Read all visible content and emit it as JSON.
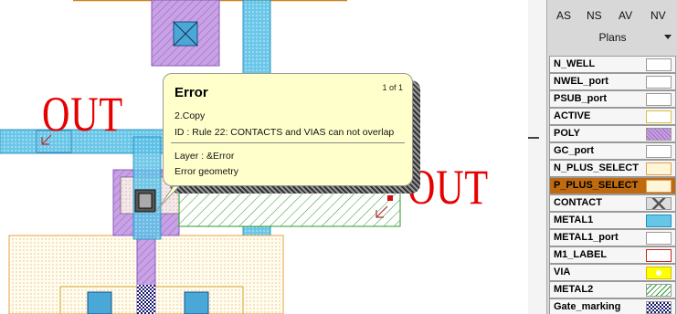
{
  "labels": {
    "out_left": "OUT",
    "out_right": "OUT"
  },
  "tooltip": {
    "title": "Error",
    "page": "1 of 1",
    "item": "2.Copy",
    "rule": "ID : Rule 22: CONTACTS and VIAS can not overlap",
    "layer": "Layer : &Error",
    "geometry": "Error geometry"
  },
  "panel": {
    "tabs": [
      "AS",
      "NS",
      "AV",
      "NV"
    ],
    "plans_label": "Plans",
    "layers": [
      {
        "name": "N_WELL",
        "swatch": "#ffffff",
        "pattern": "none"
      },
      {
        "name": "NWEL_port",
        "swatch": "#ffffff",
        "pattern": "none"
      },
      {
        "name": "PSUB_port",
        "swatch": "#ffffff",
        "pattern": "none"
      },
      {
        "name": "ACTIVE",
        "swatch": "#ffffe0",
        "pattern": "outline-yellow"
      },
      {
        "name": "POLY",
        "swatch": "#c8a0e0",
        "pattern": "hatch-purple"
      },
      {
        "name": "GC_port",
        "swatch": "#ffffff",
        "pattern": "none"
      },
      {
        "name": "N_PLUS_SELECT",
        "swatch": "#fff0c0",
        "pattern": "dots-orange"
      },
      {
        "name": "P_PLUS_SELECT",
        "swatch": "#fff0c0",
        "pattern": "dots-orange",
        "selected": true
      },
      {
        "name": "CONTACT",
        "swatch": "#d0d0d0",
        "pattern": "cross"
      },
      {
        "name": "METAL1",
        "swatch": "#66c6e8",
        "pattern": "metal1"
      },
      {
        "name": "METAL1_port",
        "swatch": "#ffffff",
        "pattern": "none"
      },
      {
        "name": "M1_LABEL",
        "swatch": "#ffffff",
        "pattern": "outline-red"
      },
      {
        "name": "VIA",
        "swatch": "#ffff00",
        "pattern": "via"
      },
      {
        "name": "METAL2",
        "swatch": "#ffffff",
        "pattern": "hatch-green"
      },
      {
        "name": "Gate_marking",
        "swatch": "#2a2a80",
        "pattern": "checker-navy"
      }
    ]
  }
}
